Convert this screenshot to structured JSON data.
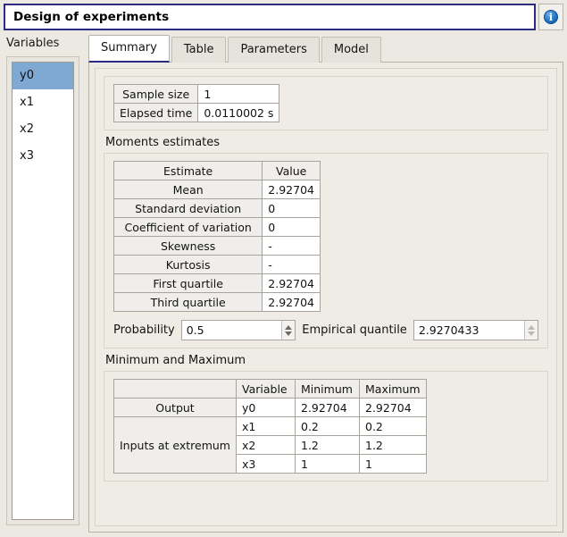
{
  "window": {
    "title": "Design of experiments",
    "info_icon": "info-icon",
    "info_glyph": "i"
  },
  "sidebar": {
    "label": "Variables",
    "items": [
      {
        "label": "y0",
        "selected": true
      },
      {
        "label": "x1",
        "selected": false
      },
      {
        "label": "x2",
        "selected": false
      },
      {
        "label": "x3",
        "selected": false
      }
    ]
  },
  "tabs": [
    {
      "label": "Summary",
      "active": true
    },
    {
      "label": "Table",
      "active": false
    },
    {
      "label": "Parameters",
      "active": false
    },
    {
      "label": "Model",
      "active": false
    }
  ],
  "summary": {
    "info_table": {
      "rows": [
        {
          "key": "Sample size",
          "value": "1"
        },
        {
          "key": "Elapsed time",
          "value": "0.0110002 s"
        }
      ]
    },
    "moments": {
      "section_label": "Moments estimates",
      "headers": [
        "Estimate",
        "Value"
      ],
      "rows": [
        {
          "estimate": "Mean",
          "value": "2.92704"
        },
        {
          "estimate": "Standard deviation",
          "value": "0"
        },
        {
          "estimate": "Coefficient of variation",
          "value": "0"
        },
        {
          "estimate": "Skewness",
          "value": "-"
        },
        {
          "estimate": "Kurtosis",
          "value": "-"
        },
        {
          "estimate": "First quartile",
          "value": "2.92704"
        },
        {
          "estimate": "Third quartile",
          "value": "2.92704"
        }
      ]
    },
    "quantile_row": {
      "probability_label": "Probability",
      "probability_value": "0.5",
      "empirical_quantile_label": "Empirical quantile",
      "empirical_quantile_value": "2.9270433"
    },
    "minmax": {
      "section_label": "Minimum and Maximum",
      "headers": [
        "",
        "Variable",
        "Minimum",
        "Maximum"
      ],
      "output_label": "Output",
      "inputs_label": "Inputs at extremum",
      "rows": [
        {
          "group": "Output",
          "variable": "y0",
          "minimum": "2.92704",
          "maximum": "2.92704"
        },
        {
          "group": "Inputs at extremum",
          "variable": "x1",
          "minimum": "0.2",
          "maximum": "0.2"
        },
        {
          "group": "Inputs at extremum",
          "variable": "x2",
          "minimum": "1.2",
          "maximum": "1.2"
        },
        {
          "group": "Inputs at extremum",
          "variable": "x3",
          "minimum": "1",
          "maximum": "1"
        }
      ]
    }
  },
  "colors": {
    "title_border": "#2b2b82",
    "selection": "#7fa9d2",
    "window_bg": "#ece9e3",
    "accent": "#2b2b82"
  }
}
